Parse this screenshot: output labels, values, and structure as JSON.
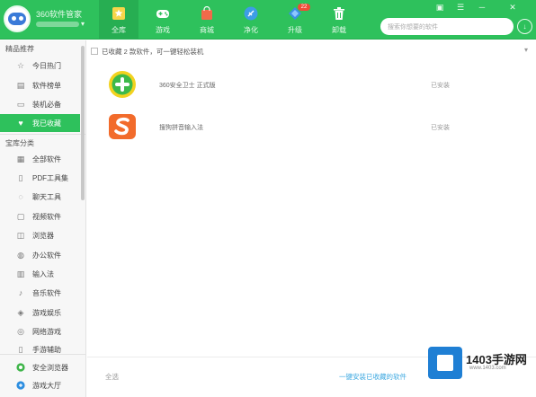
{
  "header": {
    "app_title": "360软件管家",
    "tabs": [
      {
        "label": "全库",
        "icon": "star-icon",
        "active": true
      },
      {
        "label": "游戏",
        "icon": "gamepad-icon",
        "active": false
      },
      {
        "label": "商城",
        "icon": "bag-icon",
        "active": false
      },
      {
        "label": "净化",
        "icon": "broom-icon",
        "active": false
      },
      {
        "label": "升级",
        "icon": "diamond-icon",
        "active": false,
        "badge": "22"
      },
      {
        "label": "卸载",
        "icon": "trash-icon",
        "active": false
      }
    ],
    "window_controls": [
      "shirt-icon",
      "menu-icon",
      "minimize-icon",
      "close-icon"
    ],
    "search": {
      "placeholder": "搜索你想要的软件"
    },
    "colors": {
      "brand": "#2ec15c",
      "active_tab": "#27ae52"
    }
  },
  "sidebar": {
    "section1_title": "精品推荐",
    "section1_items": [
      {
        "label": "今日热门",
        "icon": "star-icon",
        "active": false
      },
      {
        "label": "软件榜单",
        "icon": "list-icon",
        "active": false
      },
      {
        "label": "装机必备",
        "icon": "monitor-icon",
        "active": false
      },
      {
        "label": "我已收藏",
        "icon": "heart-icon",
        "active": true
      }
    ],
    "section2_title": "宝库分类",
    "section2_items": [
      {
        "label": "全部软件",
        "icon": "grid-icon"
      },
      {
        "label": "PDF工具集",
        "icon": "pdf-icon"
      },
      {
        "label": "聊天工具",
        "icon": "chat-icon"
      },
      {
        "label": "视频软件",
        "icon": "video-icon"
      },
      {
        "label": "浏览器",
        "icon": "browser-icon"
      },
      {
        "label": "办公软件",
        "icon": "office-icon"
      },
      {
        "label": "输入法",
        "icon": "keyboard-icon"
      },
      {
        "label": "音乐软件",
        "icon": "music-icon"
      },
      {
        "label": "游戏娱乐",
        "icon": "game-icon"
      },
      {
        "label": "网络游戏",
        "icon": "globe-icon"
      },
      {
        "label": "手游辅助",
        "icon": "phone-icon"
      }
    ],
    "bottom_items": [
      {
        "label": "安全浏览器",
        "icon": "browser-logo-icon"
      },
      {
        "label": "游戏大厅",
        "icon": "gamehall-icon"
      }
    ]
  },
  "main": {
    "summary": "已收藏 2 款软件，可一键轻松装机",
    "apps": [
      {
        "name": "360安全卫士 正式版",
        "status": "已安装",
        "icon": "360-safe-icon"
      },
      {
        "name": "搜狗拼音输入法",
        "status": "已安装",
        "icon": "sogou-icon"
      }
    ],
    "footer_left": "全选",
    "footer_button": "一键安装已收藏的软件"
  },
  "watermark": {
    "title": "1403手游网",
    "sub": "www.1403.com"
  }
}
